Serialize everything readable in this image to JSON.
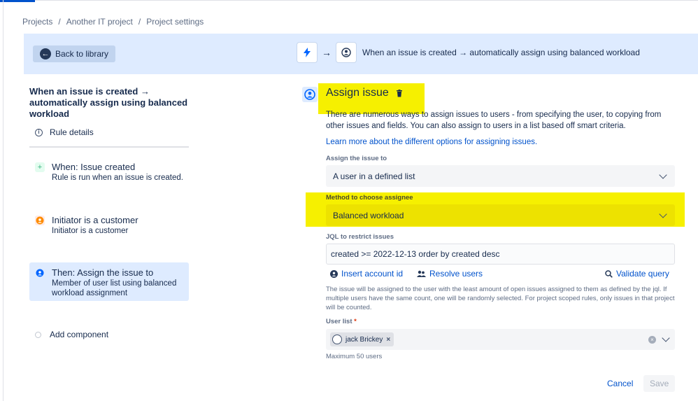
{
  "breadcrumb": {
    "items": [
      "Projects",
      "Another IT project",
      "Project settings"
    ],
    "separator": "/"
  },
  "banner": {
    "back_label": "Back to library",
    "flow_text": "When an issue is created → automatically assign using balanced workload"
  },
  "sidebar": {
    "rule_title": "When an issue is created → automatically assign using balanced workload",
    "rule_details": "Rule details",
    "components": [
      {
        "title": "When: Issue created",
        "subtitle": "Rule is run when an issue is created.",
        "icon": "plus-icon",
        "color": "#36b37e"
      },
      {
        "title": "Initiator is a customer",
        "subtitle": "Initiator is a customer",
        "icon": "condition-icon",
        "color": "#ff8b00"
      },
      {
        "title": "Then: Assign the issue to",
        "subtitle": "Member of user list using balanced workload assignment",
        "icon": "user-icon",
        "color": "#0065ff"
      }
    ],
    "add_component": "Add component"
  },
  "panel": {
    "title": "Assign issue",
    "description": "There are numerous ways to assign issues to users - from specifying the user, to copying from other issues and fields. You can also assign to users in a list based off smart criteria.",
    "learn_more": "Learn more about the different options for assigning issues.",
    "assign_label": "Assign the issue to",
    "assign_value": "A user in a defined list",
    "method_label": "Method to choose assignee",
    "method_value": "Balanced workload",
    "jql_label": "JQL to restrict issues",
    "jql_value": "created >= 2022-12-13 order by created desc",
    "insert_account": "Insert account id",
    "resolve_users": "Resolve users",
    "validate_query": "Validate query",
    "help_text": "The issue will be assigned to the user with the least amount of open issues assigned to them as defined by the jql. If multiple users have the same count, one will be randomly selected. For project scoped rules, only issues in that project will be counted.",
    "userlist_label": "User list",
    "required_mark": "*",
    "user_chip": "jack Brickey",
    "chip_remove": "×",
    "max_users": "Maximum 50 users",
    "cancel": "Cancel",
    "save": "Save"
  },
  "colors": {
    "accent": "#0052cc",
    "highlight": "#f6f000",
    "banner_bg": "#deebff"
  }
}
